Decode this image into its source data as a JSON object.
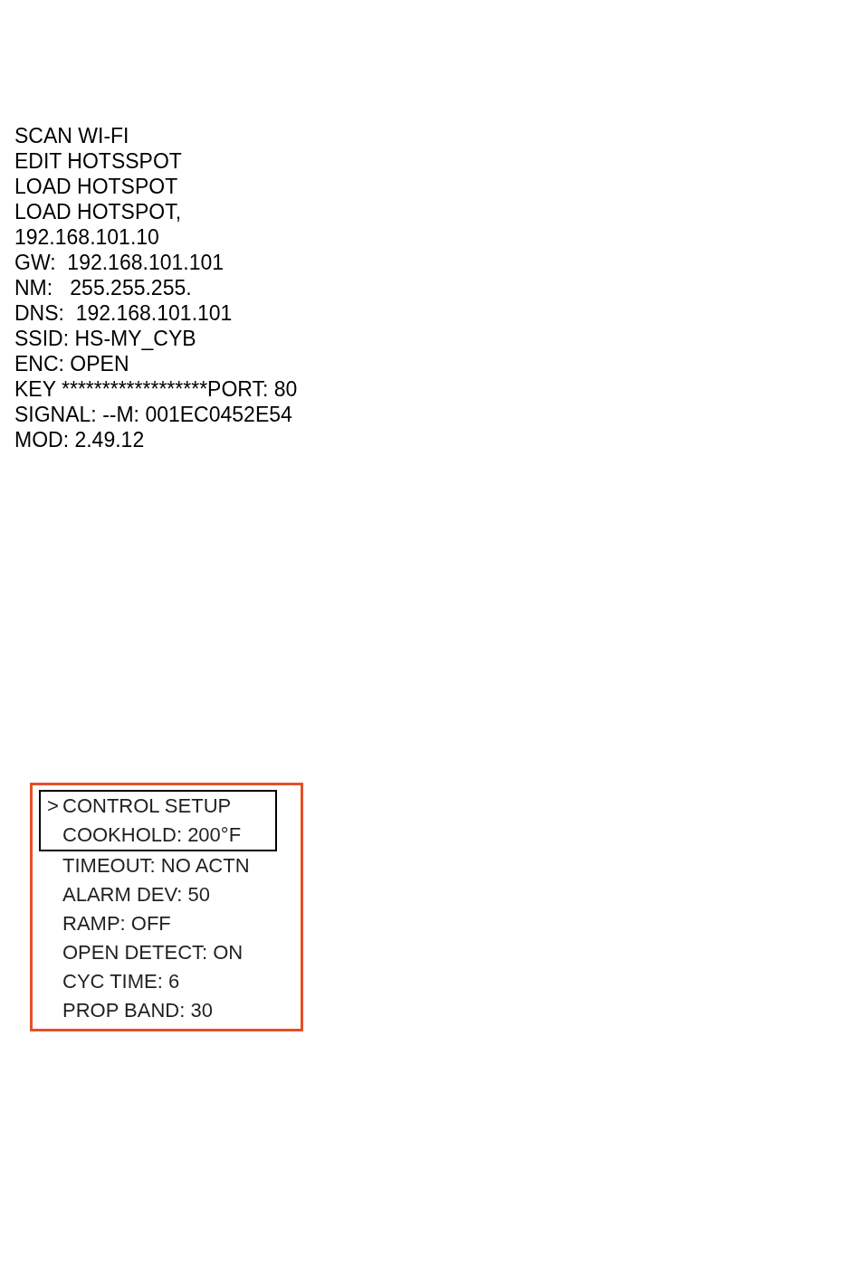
{
  "wifi_screen": {
    "lines": [
      "SCAN WI-FI",
      "EDIT HOTSSPOT",
      "LOAD HOTSPOT",
      "LOAD HOTSPOT,",
      "192.168.101.10",
      "GW:  192.168.101.101",
      "NM:   255.255.255.",
      "DNS:  192.168.101.101",
      "SSID: HS-MY_CYB",
      "ENC: OPEN",
      "KEY ******************PORT: 80",
      "SIGNAL: --M: 001EC0452E54",
      "MOD: 2.49.12"
    ]
  },
  "control_menu": {
    "items": [
      {
        "cursor": ">",
        "label": "CONTROL SETUP",
        "framed": true
      },
      {
        "label": "COOKHOLD: 200°F",
        "framed": true
      },
      {
        "label": "TIMEOUT: NO ACTN",
        "framed": false
      },
      {
        "label": "ALARM DEV: 50",
        "framed": false
      },
      {
        "label": "RAMP: OFF",
        "framed": false
      },
      {
        "label": "OPEN DETECT: ON",
        "framed": false
      },
      {
        "label": "CYC TIME: 6",
        "framed": false
      },
      {
        "label": "PROP BAND: 30",
        "framed": false
      }
    ]
  }
}
